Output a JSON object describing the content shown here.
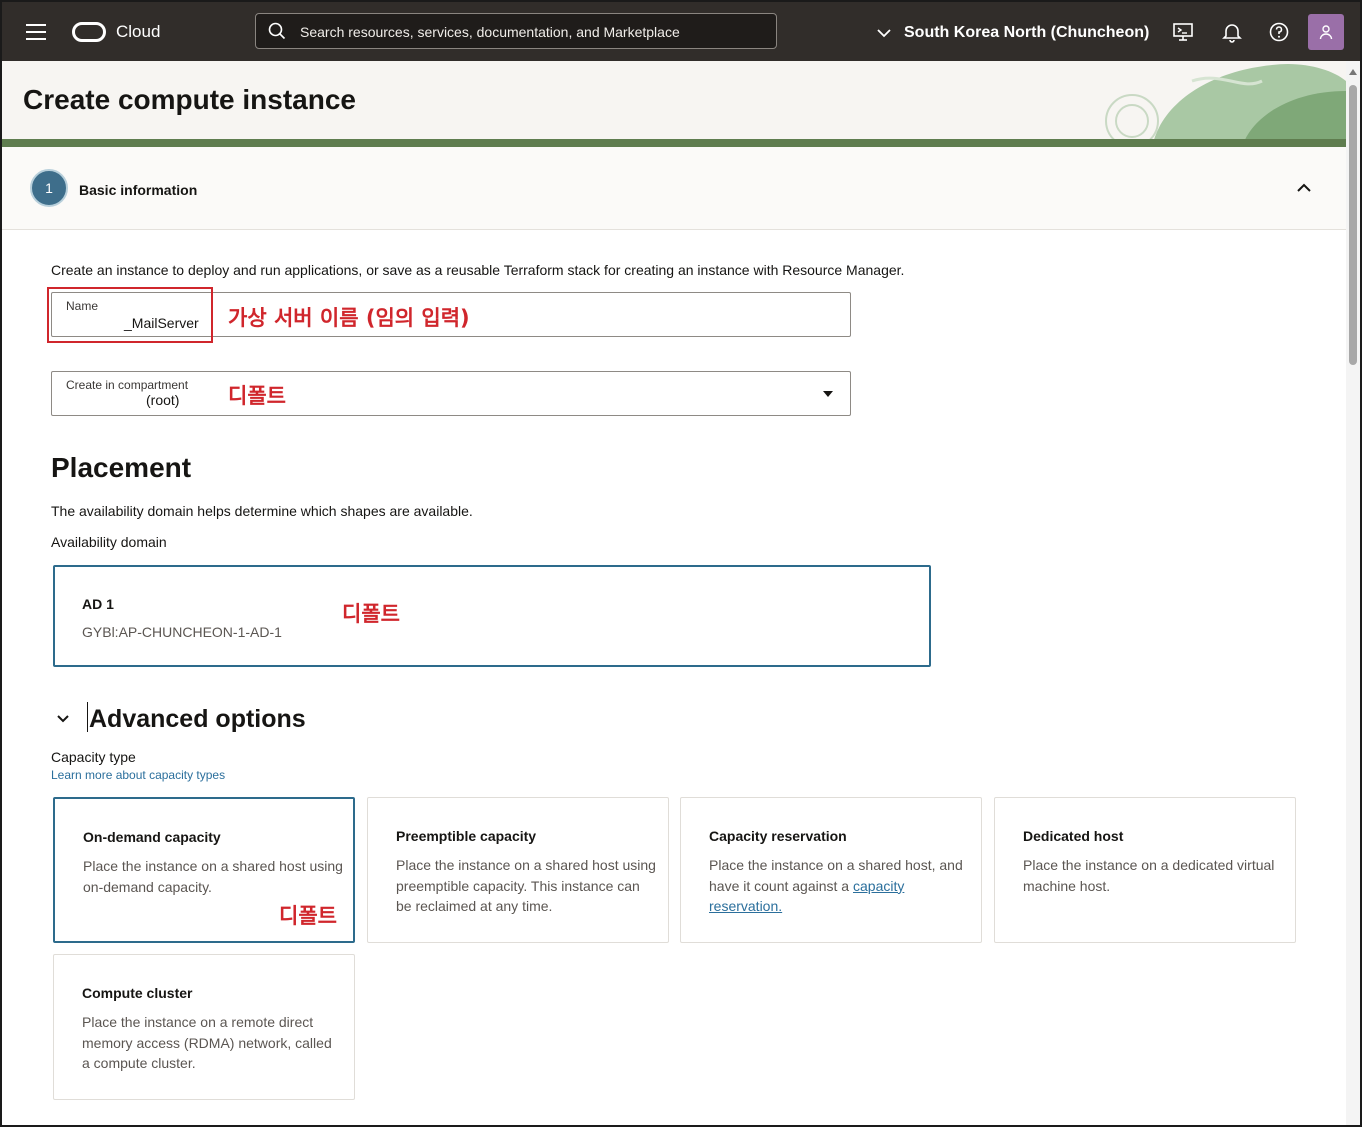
{
  "topbar": {
    "brand": "Cloud",
    "search_placeholder": "Search resources, services, documentation, and Marketplace",
    "region": "South Korea North (Chuncheon)"
  },
  "header": {
    "title": "Create compute instance"
  },
  "step": {
    "number": "1",
    "title": "Basic information"
  },
  "basic": {
    "intro": "Create an instance to deploy and run applications, or save as a reusable Terraform stack for creating an instance with Resource Manager.",
    "name_label": "Name",
    "name_value": "_MailServer",
    "compartment_label": "Create in compartment",
    "compartment_value": "(root)"
  },
  "annotations": {
    "name_note": "가상 서버 이름 (임의 입력)",
    "compartment_note": "디폴트",
    "ad_note": "디폴트",
    "capacity_note": "디폴트",
    "color": "#d0262c"
  },
  "placement": {
    "title": "Placement",
    "description": "The availability domain helps determine which shapes are available.",
    "ad_label": "Availability domain",
    "ad_name": "AD 1",
    "ad_id": "GYBl:AP-CHUNCHEON-1-AD-1"
  },
  "advanced": {
    "title": "Advanced options",
    "capacity_label": "Capacity type",
    "capacity_link": "Learn more about capacity types",
    "cards": [
      {
        "title": "On-demand capacity",
        "desc": "Place the instance on a shared host using on-demand capacity."
      },
      {
        "title": "Preemptible capacity",
        "desc": "Place the instance on a shared host using preemptible capacity. This instance can be reclaimed at any time."
      },
      {
        "title": "Capacity reservation",
        "desc": "Place the instance on a shared host, and have it count against a",
        "link": "capacity reservation."
      },
      {
        "title": "Dedicated host",
        "desc": "Place the instance on a dedicated virtual machine host."
      },
      {
        "title": "Compute cluster",
        "desc": "Place the instance on a remote direct memory access (RDMA) network, called a compute cluster."
      }
    ]
  },
  "colors": {
    "topbar": "#312d2a",
    "accent": "#2d6b8c",
    "link": "#2b6f9c"
  }
}
